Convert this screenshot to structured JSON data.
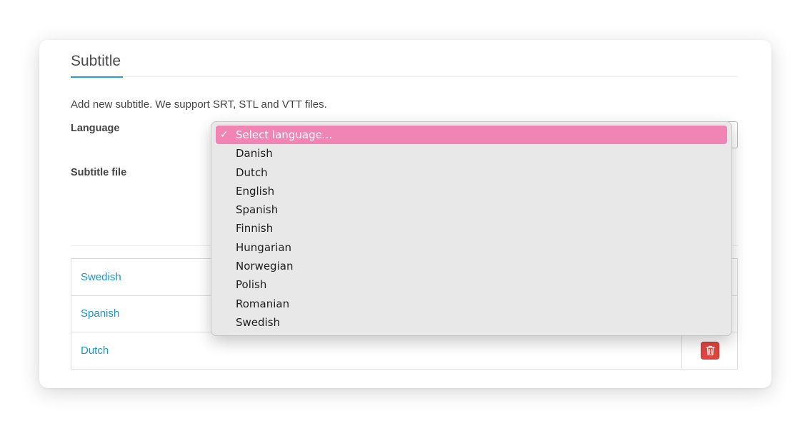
{
  "section": {
    "title": "Subtitle"
  },
  "form": {
    "intro": "Add new subtitle. We support SRT, STL and VTT files.",
    "language_label": "Language",
    "file_label": "Subtitle file"
  },
  "language_select": {
    "selected": "Select language...",
    "options": [
      {
        "label": "Select language...",
        "selected": true
      },
      {
        "label": "Danish"
      },
      {
        "label": "Dutch"
      },
      {
        "label": "English"
      },
      {
        "label": "Spanish"
      },
      {
        "label": "Finnish"
      },
      {
        "label": "Hungarian"
      },
      {
        "label": "Norwegian"
      },
      {
        "label": "Polish"
      },
      {
        "label": "Romanian"
      },
      {
        "label": "Swedish"
      }
    ],
    "checkmark": "✓"
  },
  "subtitles": [
    {
      "language": "Swedish"
    },
    {
      "language": "Spanish"
    },
    {
      "language": "Dutch"
    }
  ],
  "colors": {
    "accent": "#1ea0d2",
    "link": "#1a95c9",
    "delete": "#e0453f",
    "highlight": "#f084b4"
  },
  "icons": {
    "delete": "trash-icon"
  }
}
